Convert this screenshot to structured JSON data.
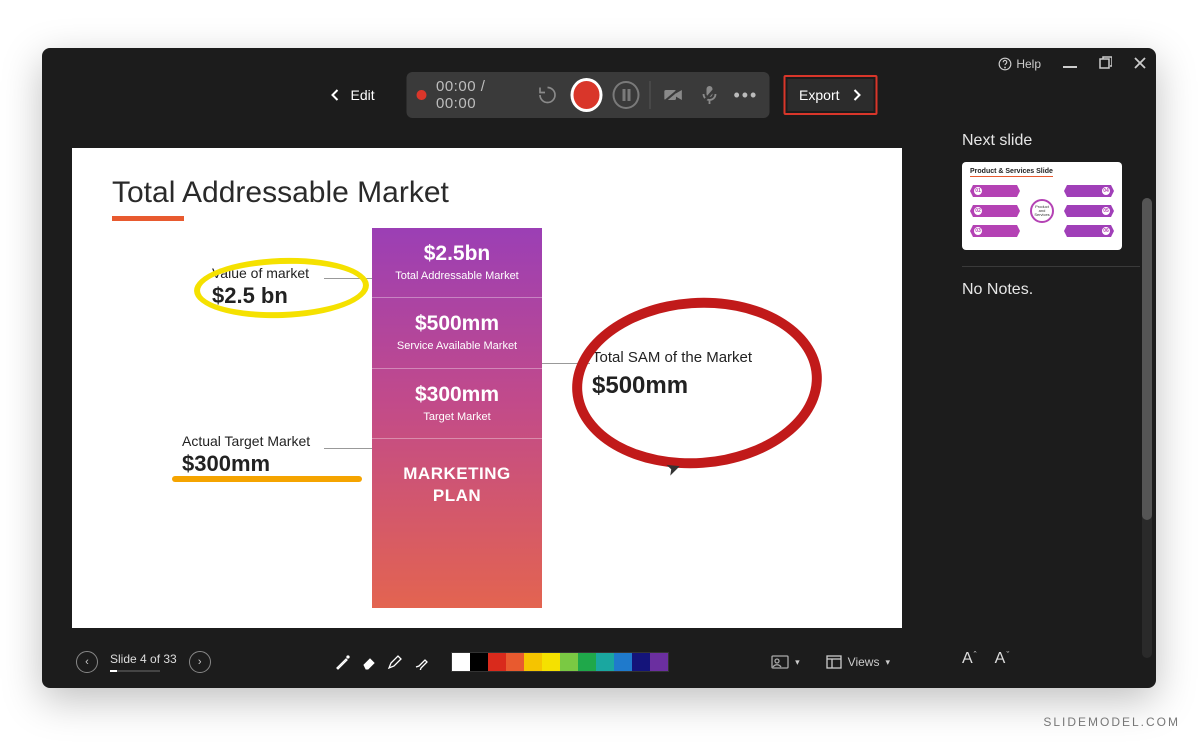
{
  "titlebar": {
    "help": "Help"
  },
  "toolbar": {
    "edit": "Edit",
    "time_current": "00:00",
    "time_total": "00:00",
    "export": "Export"
  },
  "right_panel": {
    "next_slide_label": "Next slide",
    "thumb_title": "Product & Services Slide",
    "thumb_center": "Product and Services",
    "thumb_items": [
      "01",
      "02",
      "03",
      "04",
      "05",
      "06"
    ],
    "notes_label": "No Notes."
  },
  "slide": {
    "title": "Total Addressable Market",
    "left1_label": "Value of market",
    "left1_value": "$2.5 bn",
    "left2_label": "Actual Target Market",
    "left2_value": "$300mm",
    "right_label": "Total SAM of the Market",
    "right_value": "$500mm",
    "pillar": [
      {
        "big": "$2.5bn",
        "sm": "Total Addressable Market"
      },
      {
        "big": "$500mm",
        "sm": "Service Available Market"
      },
      {
        "big": "$300mm",
        "sm": "Target Market"
      }
    ],
    "plan": "MARKETING PLAN"
  },
  "bottom": {
    "slide_counter": "Slide 4 of 33",
    "views_label": "Views",
    "palette": [
      "#ffffff",
      "#000000",
      "#d92a1c",
      "#e85a2f",
      "#f5c400",
      "#f5e100",
      "#7ac943",
      "#1fa84a",
      "#1aa7a0",
      "#1f7acc",
      "#14147a",
      "#6b2fa0"
    ]
  },
  "watermark": "SLIDEMODEL.COM"
}
